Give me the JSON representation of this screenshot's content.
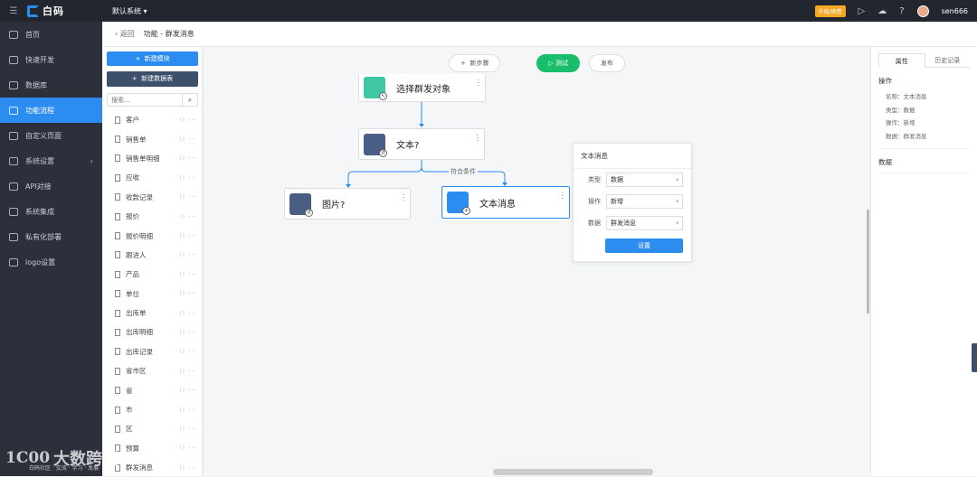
{
  "topbar": {
    "logo_text": "白码",
    "system_select": "默认系统",
    "upgrade_badge": "升级/续费",
    "username": "sen666"
  },
  "sidebar": {
    "items": [
      {
        "label": "首页"
      },
      {
        "label": "快速开发"
      },
      {
        "label": "数据库"
      },
      {
        "label": "功能流程"
      },
      {
        "label": "自定义页面"
      },
      {
        "label": "系统设置"
      },
      {
        "label": "API对接"
      },
      {
        "label": "系统集成"
      },
      {
        "label": "私有化部署"
      },
      {
        "label": "logo设置"
      }
    ]
  },
  "breadcrumb": {
    "back": "返回",
    "path": "功能 - 群发消息"
  },
  "left_panel": {
    "new_module": "新建模块",
    "new_table": "新建数据表",
    "search_placeholder": "搜索...",
    "tables": [
      "客户",
      "销售单",
      "销售单明细",
      "应收",
      "收款记录",
      "报价",
      "报价明细",
      "跟进人",
      "产品",
      "单位",
      "出库单",
      "出库明细",
      "出库记录",
      "省市区",
      "省",
      "市",
      "区",
      "预算",
      "群发消息"
    ]
  },
  "canvas": {
    "toolbar": {
      "new_step": "新步骤",
      "test": "测试",
      "publish": "发布"
    },
    "nodes": {
      "select_target": "选择群发对象",
      "text_cond": "文本?",
      "image_cond": "图片?",
      "text_msg": "文本消息"
    },
    "branch_label": "符合条件"
  },
  "popup": {
    "title": "文本消息",
    "rows": [
      {
        "label": "类型",
        "value": "数据"
      },
      {
        "label": "操作",
        "value": "新增"
      },
      {
        "label": "数据",
        "value": "群发消息"
      }
    ],
    "button": "设置"
  },
  "right_panel": {
    "tabs": [
      "属性",
      "历史记录"
    ],
    "section_op": "操作",
    "lines": [
      "名称：文本消息",
      "类型：数据",
      "操作：新增",
      "数据：群发消息"
    ],
    "section_data": "数据"
  },
  "watermark": {
    "logo": "1C00",
    "text": "大数跨境",
    "sub": "白码社区 · 交流 · 学习 · 发展"
  },
  "colors": {
    "accent": "#2d8cf0",
    "sidebar": "#2b303b",
    "topbar": "#22262f",
    "success": "#19be6b"
  }
}
